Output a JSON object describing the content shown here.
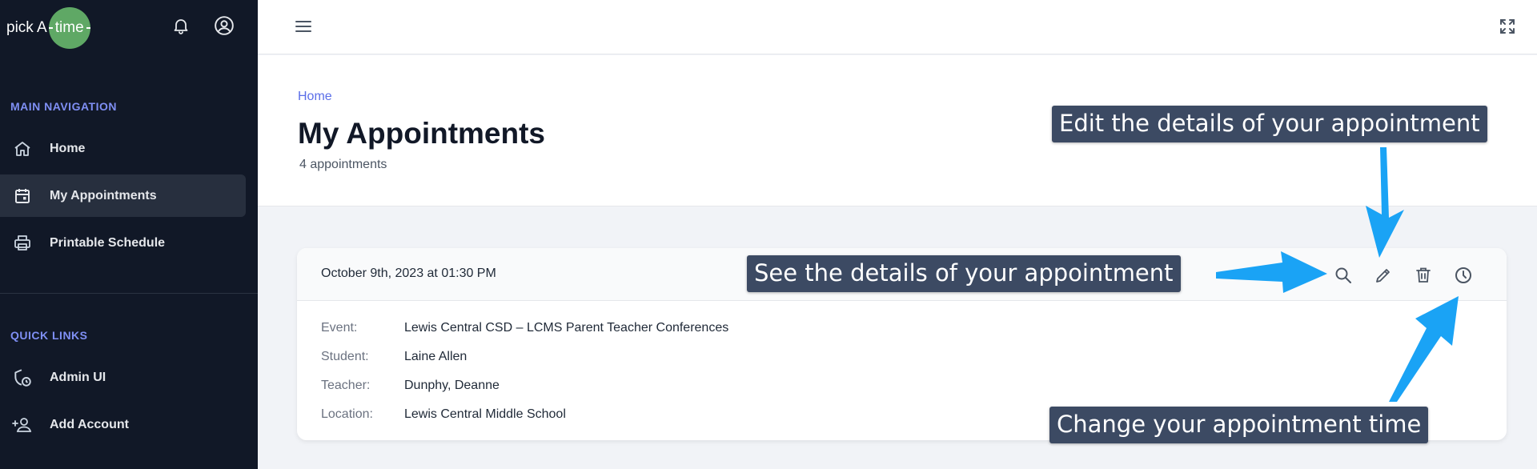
{
  "brand": {
    "pick": "pick A",
    "time": "time"
  },
  "sidebar": {
    "main_heading": "MAIN NAVIGATION",
    "items": [
      {
        "label": "Home",
        "icon": "home-icon"
      },
      {
        "label": "My Appointments",
        "icon": "calendar-icon",
        "active": true
      },
      {
        "label": "Printable Schedule",
        "icon": "printer-icon"
      }
    ],
    "quick_heading": "QUICK LINKS",
    "quick_items": [
      {
        "label": "Admin UI",
        "icon": "shield-clock-icon"
      },
      {
        "label": "Add Account",
        "icon": "person-add-icon"
      }
    ]
  },
  "header": {
    "breadcrumb": "Home",
    "title": "My Appointments",
    "subtitle": "4 appointments"
  },
  "appointment": {
    "datetime": "October 9th, 2023 at 01:30 PM",
    "details": [
      {
        "label": "Event:",
        "value": "Lewis Central CSD – LCMS Parent Teacher Conferences"
      },
      {
        "label": "Student:",
        "value": "Laine Allen"
      },
      {
        "label": "Teacher:",
        "value": "Dunphy, Deanne"
      },
      {
        "label": "Location:",
        "value": "Lewis Central Middle School"
      }
    ],
    "actions": [
      "search-icon",
      "pencil-icon",
      "trash-icon",
      "clock-icon"
    ]
  },
  "callouts": {
    "edit": "Edit the details of your appointment",
    "see": "See the details of your appointment",
    "change": "Change your appointment time"
  },
  "colors": {
    "sidebar_bg": "#111827",
    "accent": "#5b6ee8",
    "brand_green": "#5fa865",
    "callout_bg": "#3c4a63",
    "arrow": "#1aa3f5"
  }
}
